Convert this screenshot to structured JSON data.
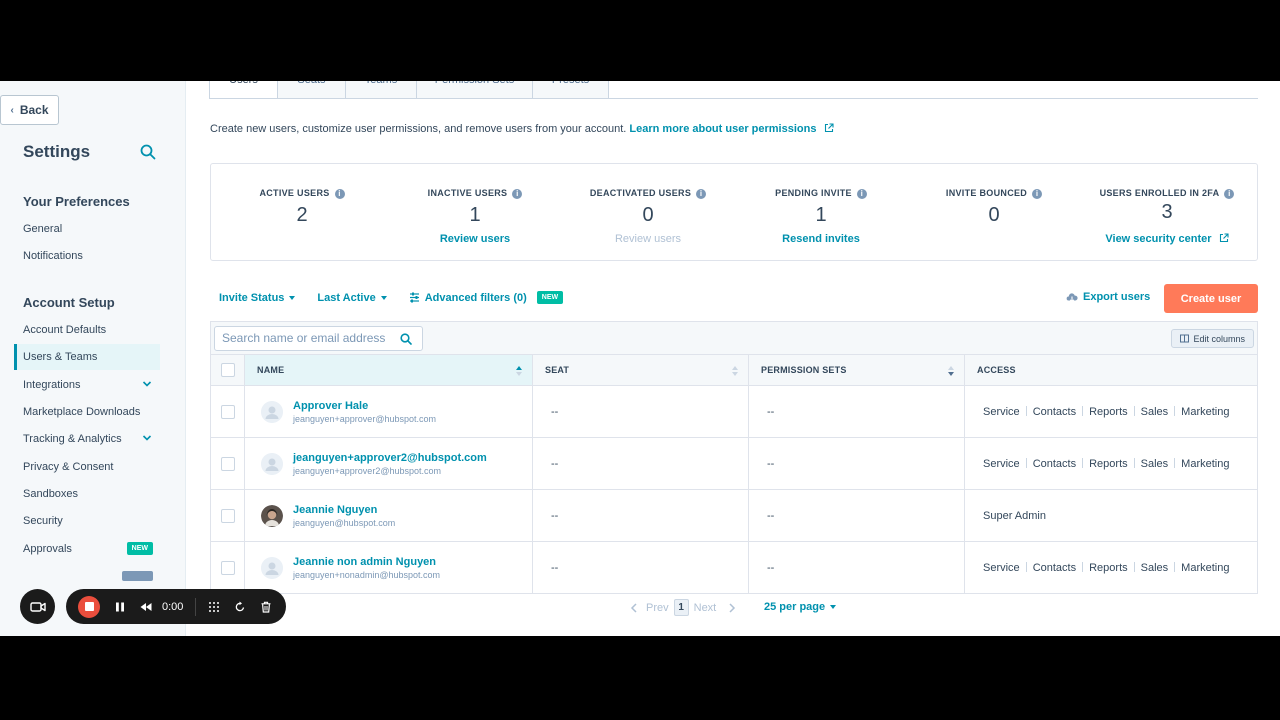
{
  "sidebar": {
    "back_label": "Back",
    "title": "Settings",
    "sections": [
      {
        "heading": "Your Preferences",
        "items": [
          "General",
          "Notifications"
        ]
      },
      {
        "heading": "Account Setup",
        "items": [
          "Account Defaults",
          "Users & Teams",
          "Integrations",
          "Marketplace Downloads",
          "Tracking & Analytics",
          "Privacy & Consent",
          "Sandboxes",
          "Security",
          "Approvals"
        ]
      }
    ],
    "new_badge": "NEW",
    "active_item": "Users & Teams"
  },
  "tabs": [
    "Users",
    "Seats",
    "Teams",
    "Permission Sets",
    "Presets"
  ],
  "description": {
    "text": "Create new users, customize user permissions, and remove users from your account.",
    "link": "Learn more about user permissions"
  },
  "stats": [
    {
      "label": "ACTIVE USERS",
      "value": "2",
      "link": ""
    },
    {
      "label": "INACTIVE USERS",
      "value": "1",
      "link": "Review users"
    },
    {
      "label": "DEACTIVATED USERS",
      "value": "0",
      "link": "Review users"
    },
    {
      "label": "PENDING INVITE",
      "value": "1",
      "link": "Resend invites"
    },
    {
      "label": "INVITE BOUNCED",
      "value": "0",
      "link": ""
    },
    {
      "label": "USERS ENROLLED IN 2FA",
      "value": "3",
      "link": "View security center"
    }
  ],
  "filters": {
    "invite_status": "Invite Status",
    "last_active": "Last Active",
    "advanced": "Advanced filters (0)",
    "advanced_badge": "NEW"
  },
  "actions": {
    "export": "Export users",
    "create": "Create user"
  },
  "search": {
    "placeholder": "Search name or email address"
  },
  "edit_columns": "Edit columns",
  "table": {
    "columns": [
      "NAME",
      "SEAT",
      "PERMISSION SETS",
      "ACCESS"
    ],
    "rows": [
      {
        "name": "Approver Hale",
        "email": "jeanguyen+approver@hubspot.com",
        "seat": "--",
        "permission_sets": "--",
        "access": [
          "Service",
          "Contacts",
          "Reports",
          "Sales",
          "Marketing"
        ]
      },
      {
        "name": "jeanguyen+approver2@hubspot.com",
        "email": "jeanguyen+approver2@hubspot.com",
        "seat": "--",
        "permission_sets": "--",
        "access": [
          "Service",
          "Contacts",
          "Reports",
          "Sales",
          "Marketing"
        ]
      },
      {
        "name": "Jeannie Nguyen",
        "email": "jeanguyen@hubspot.com",
        "seat": "--",
        "permission_sets": "--",
        "access": [
          "Super Admin"
        ]
      },
      {
        "name": "Jeannie non admin Nguyen",
        "email": "jeanguyen+nonadmin@hubspot.com",
        "seat": "--",
        "permission_sets": "--",
        "access": [
          "Service",
          "Contacts",
          "Reports",
          "Sales",
          "Marketing"
        ]
      }
    ]
  },
  "pagination": {
    "prev": "Prev",
    "page": "1",
    "next": "Next",
    "per_page": "25 per page"
  },
  "recorder": {
    "time": "0:00"
  },
  "colors": {
    "accent": "#0091ae",
    "primary_button": "#ff7a59",
    "new_badge": "#00bda5",
    "record": "#ea4e3d"
  }
}
